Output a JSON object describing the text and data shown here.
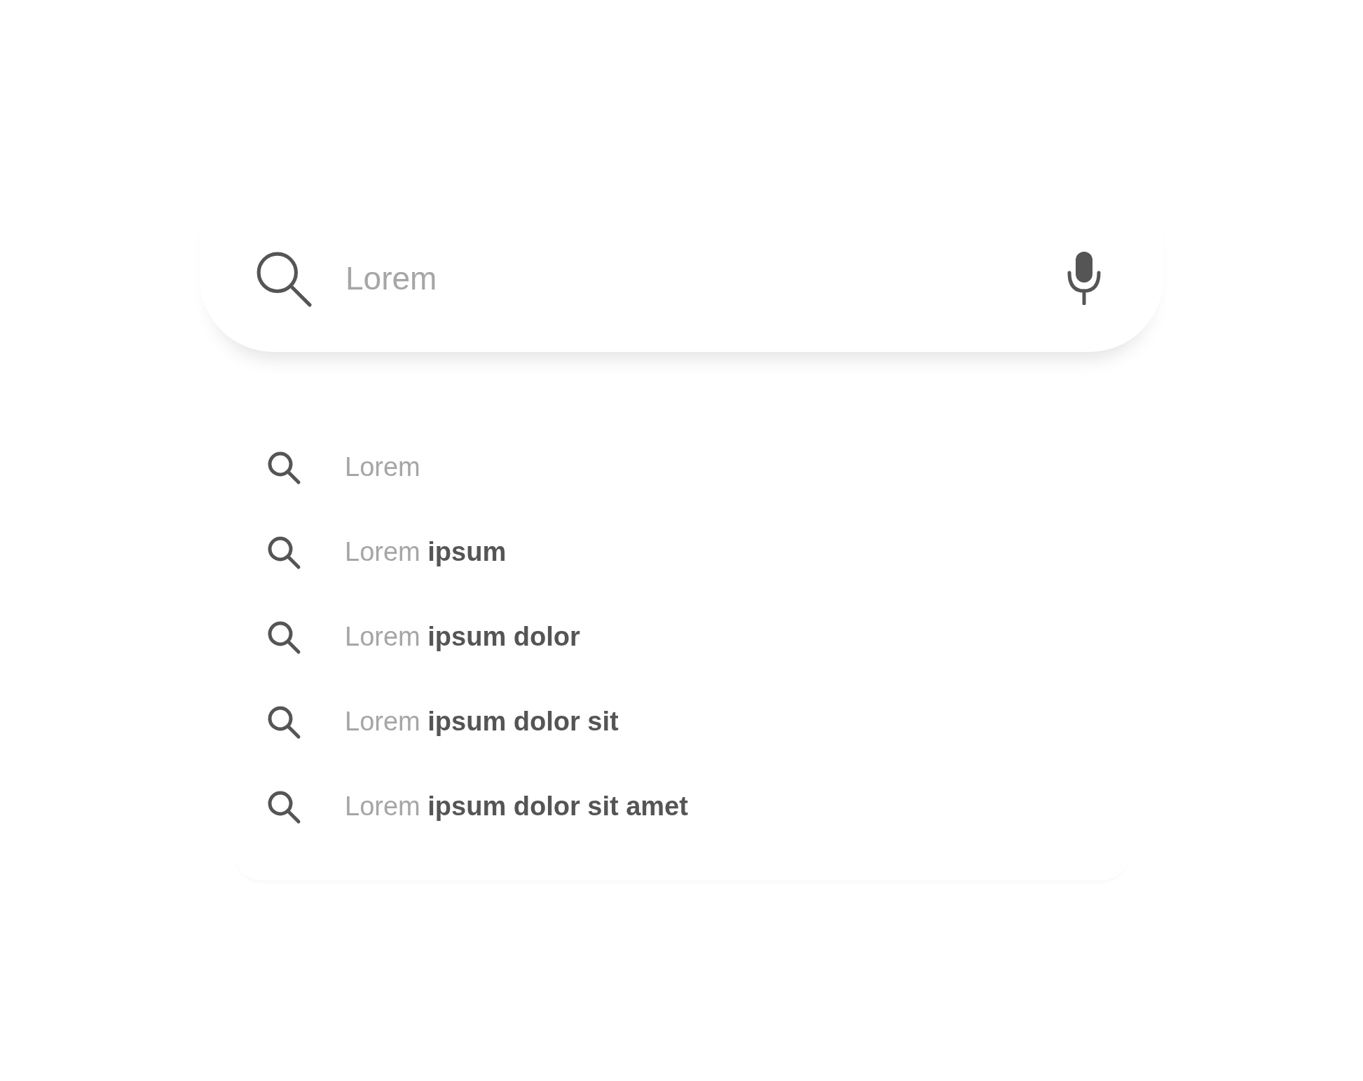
{
  "search": {
    "placeholder": "Lorem"
  },
  "suggestions": [
    {
      "text": "Lorem"
    },
    {
      "text": "Lorem **ipsum**"
    },
    {
      "text": "Lorem **ipsum dolor**"
    },
    {
      "text": "Lorem **ipsum dolor sit**"
    },
    {
      "text": "Lorem **ipsum dolor sit amet**"
    }
  ]
}
